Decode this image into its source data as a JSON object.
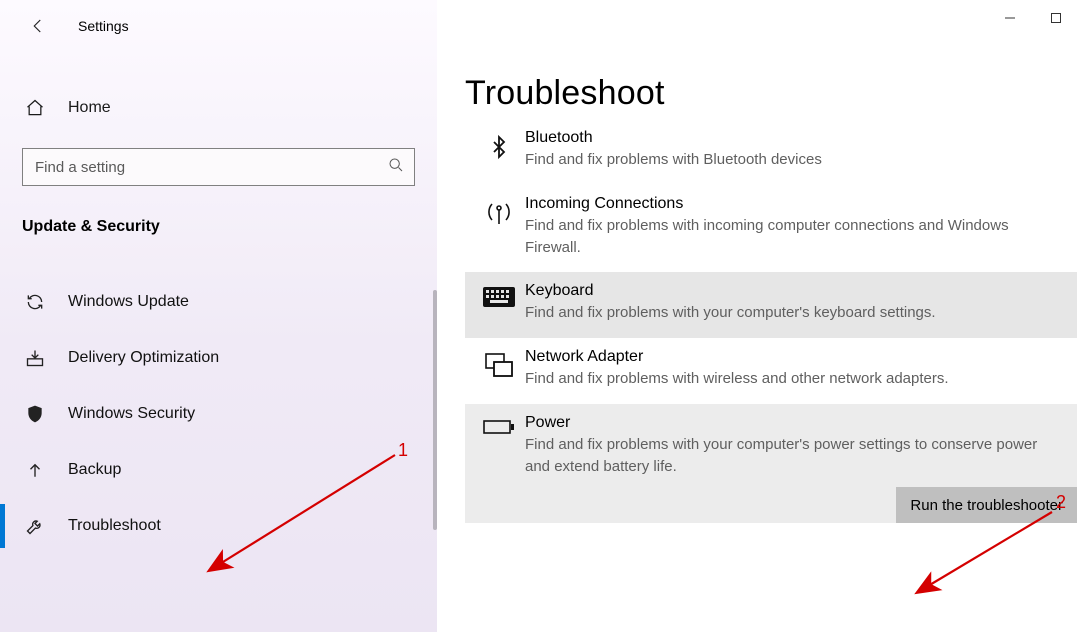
{
  "app": {
    "title": "Settings"
  },
  "sidebar": {
    "home_label": "Home",
    "search_placeholder": "Find a setting",
    "category_label": "Update & Security",
    "items": [
      {
        "label": "Windows Update",
        "icon": "sync-icon"
      },
      {
        "label": "Delivery Optimization",
        "icon": "download-box-icon"
      },
      {
        "label": "Windows Security",
        "icon": "shield-icon"
      },
      {
        "label": "Backup",
        "icon": "backup-arrow-icon"
      },
      {
        "label": "Troubleshoot",
        "icon": "wrench-icon",
        "active": true
      }
    ]
  },
  "page": {
    "title": "Troubleshoot",
    "items": [
      {
        "title": "Bluetooth",
        "desc": "Find and fix problems with Bluetooth devices",
        "icon": "bluetooth-icon",
        "selected": false
      },
      {
        "title": "Incoming Connections",
        "desc": "Find and fix problems with incoming computer connections and Windows Firewall.",
        "icon": "antenna-icon",
        "selected": false
      },
      {
        "title": "Keyboard",
        "desc": "Find and fix problems with your computer's keyboard settings.",
        "icon": "keyboard-icon",
        "selected": true
      },
      {
        "title": "Network Adapter",
        "desc": "Find and fix problems with wireless and other network adapters.",
        "icon": "network-adapter-icon",
        "selected": false
      },
      {
        "title": "Power",
        "desc": "Find and fix problems with your computer's power settings to conserve power and extend battery life.",
        "icon": "battery-icon",
        "selected": true
      }
    ],
    "run_button_label": "Run the troubleshooter"
  },
  "annotations": {
    "label1": "1",
    "label2": "2"
  }
}
